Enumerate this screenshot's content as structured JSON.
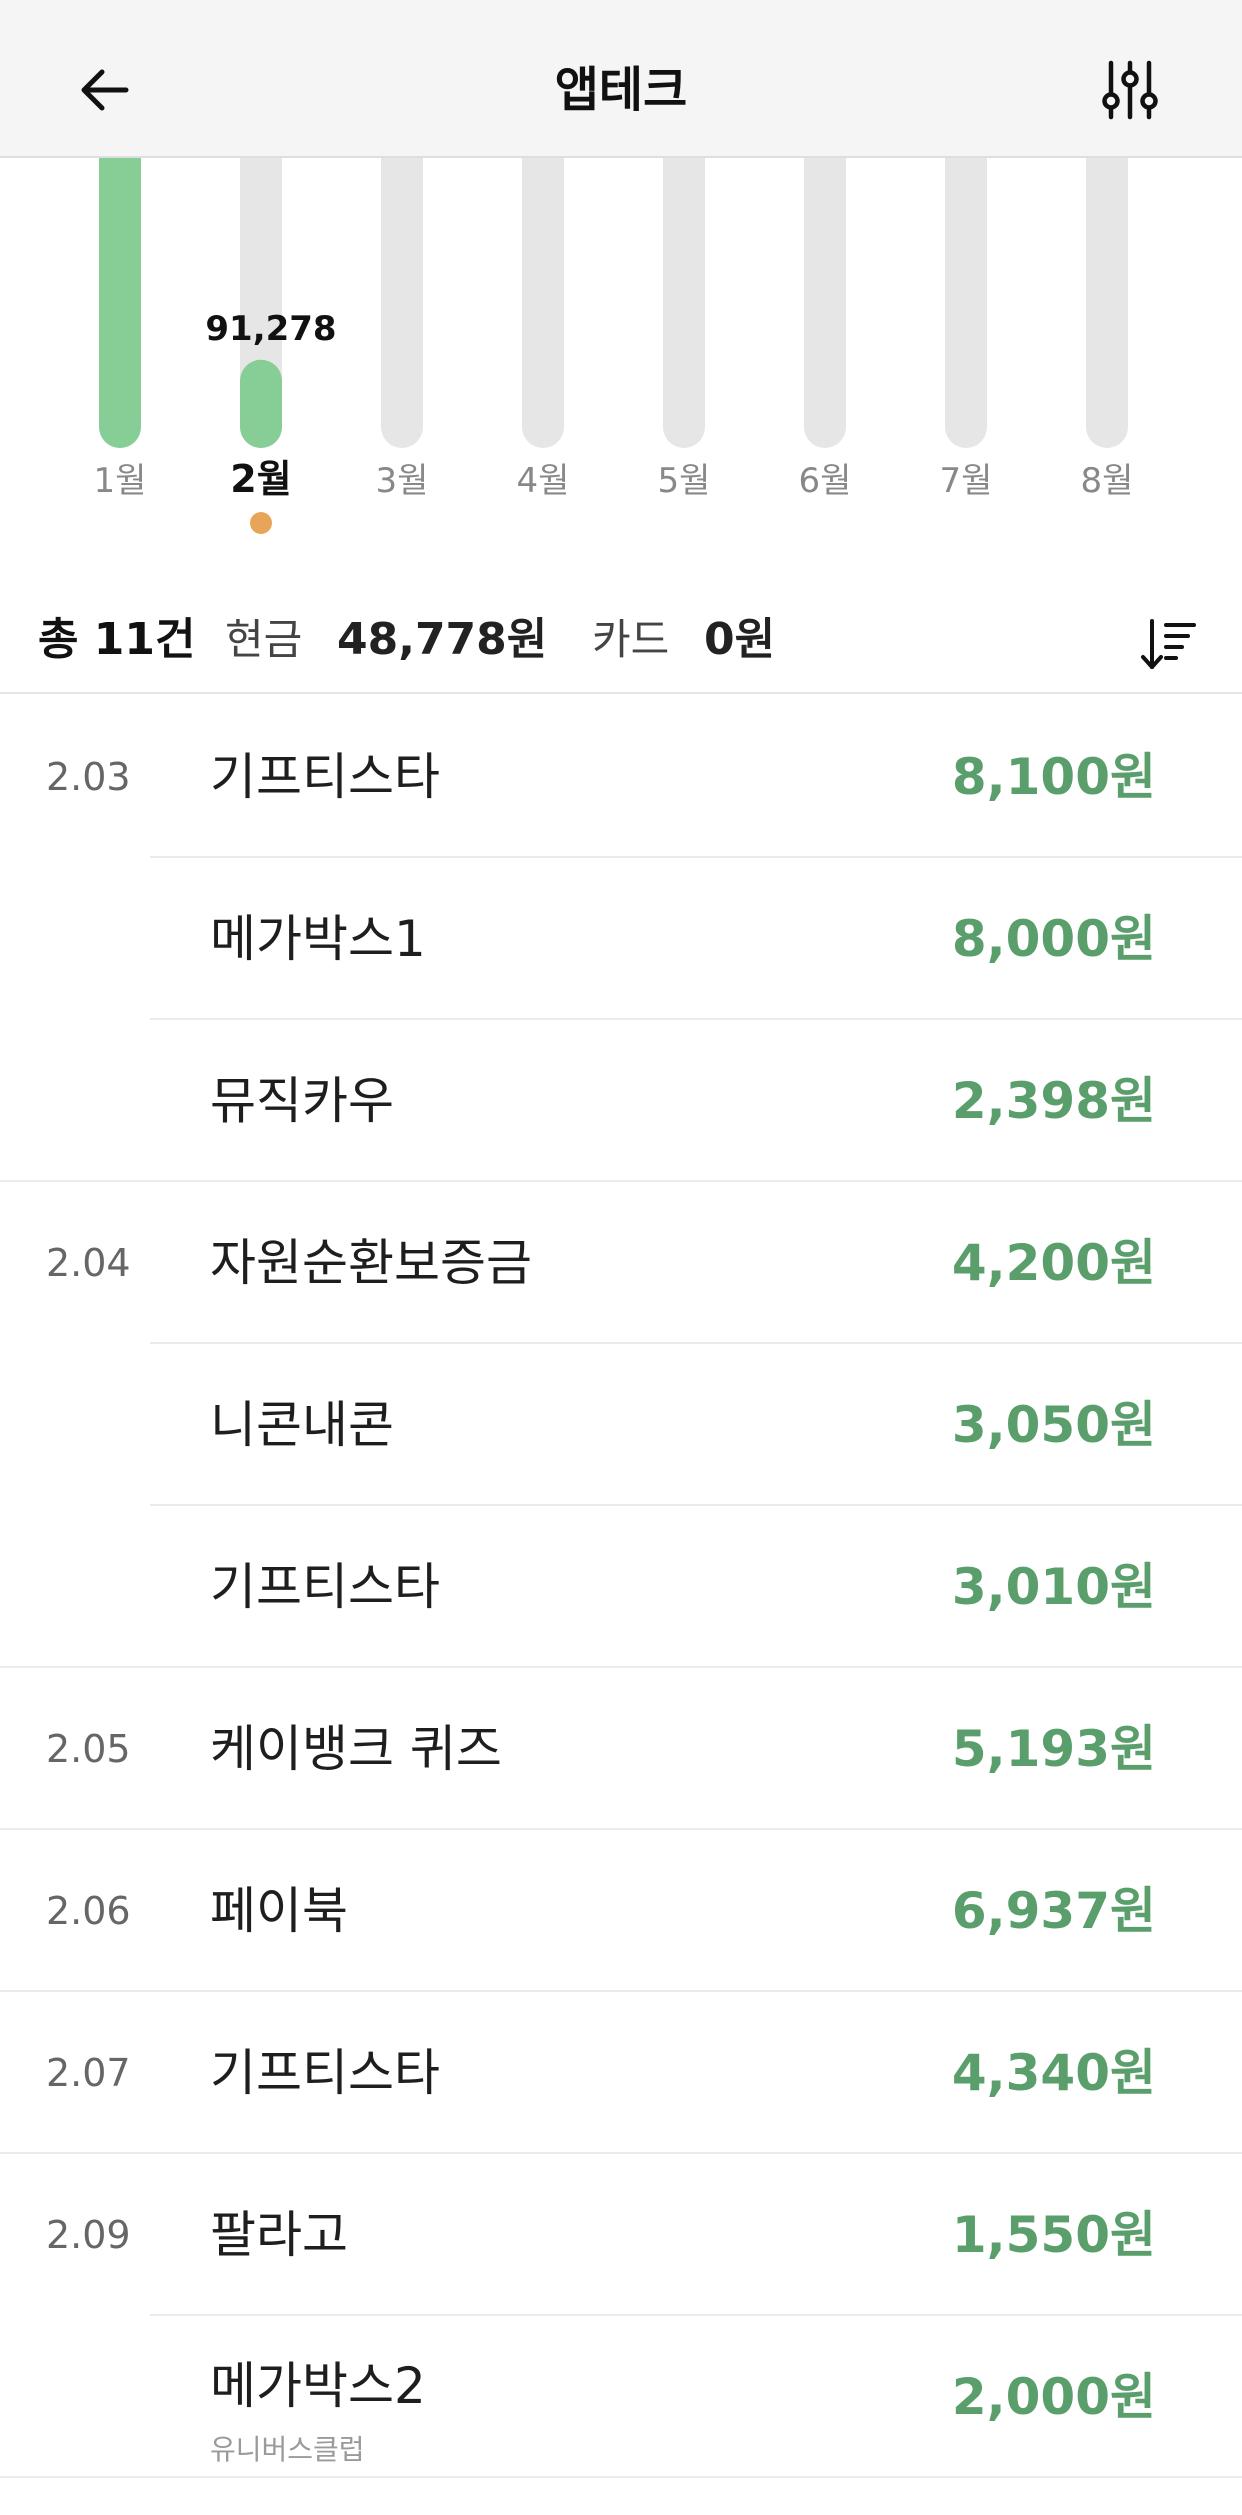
{
  "header": {
    "title": "앱테크"
  },
  "chart_data": {
    "type": "bar",
    "categories": [
      "1월",
      "2월",
      "3월",
      "4월",
      "5월",
      "6월",
      "7월",
      "8월"
    ],
    "values": [
      300000,
      91278,
      0,
      0,
      0,
      0,
      0,
      0
    ],
    "ylim": [
      0,
      300000
    ],
    "selected_index": 1,
    "selected_label": "91,278",
    "colors": {
      "bar_fill": "#86cd96",
      "bar_track": "#e6e6e6",
      "selected_dot": "#e8a55a",
      "label": "#888888",
      "label_selected": "#111111"
    }
  },
  "summary": {
    "total": "총 11건",
    "cash_label": "현금",
    "cash_value": "48,778원",
    "card_label": "카드",
    "card_value": "0원"
  },
  "icons": {
    "back": "arrow-left-icon",
    "filter": "sliders-icon",
    "sort": "sort-descending-icon"
  },
  "list": [
    {
      "date": "2.03",
      "name": "기프티스타",
      "amount": "8,100원",
      "sub": "",
      "divider": "inset"
    },
    {
      "date": "",
      "name": "메가박스1",
      "amount": "8,000원",
      "sub": "",
      "divider": "inset"
    },
    {
      "date": "",
      "name": "뮤직카우",
      "amount": "2,398원",
      "sub": "",
      "divider": "full"
    },
    {
      "date": "2.04",
      "name": "자원순환보증금",
      "amount": "4,200원",
      "sub": "",
      "divider": "inset"
    },
    {
      "date": "",
      "name": "니콘내콘",
      "amount": "3,050원",
      "sub": "",
      "divider": "inset"
    },
    {
      "date": "",
      "name": "기프티스타",
      "amount": "3,010원",
      "sub": "",
      "divider": "full"
    },
    {
      "date": "2.05",
      "name": "케이뱅크 퀴즈",
      "amount": "5,193원",
      "sub": "",
      "divider": "full"
    },
    {
      "date": "2.06",
      "name": "페이북",
      "amount": "6,937원",
      "sub": "",
      "divider": "full"
    },
    {
      "date": "2.07",
      "name": "기프티스타",
      "amount": "4,340원",
      "sub": "",
      "divider": "full"
    },
    {
      "date": "2.09",
      "name": "팔라고",
      "amount": "1,550원",
      "sub": "",
      "divider": "inset"
    },
    {
      "date": "",
      "name": "메가박스2",
      "amount": "2,000원",
      "sub": "유니버스클럽",
      "divider": "full"
    }
  ]
}
